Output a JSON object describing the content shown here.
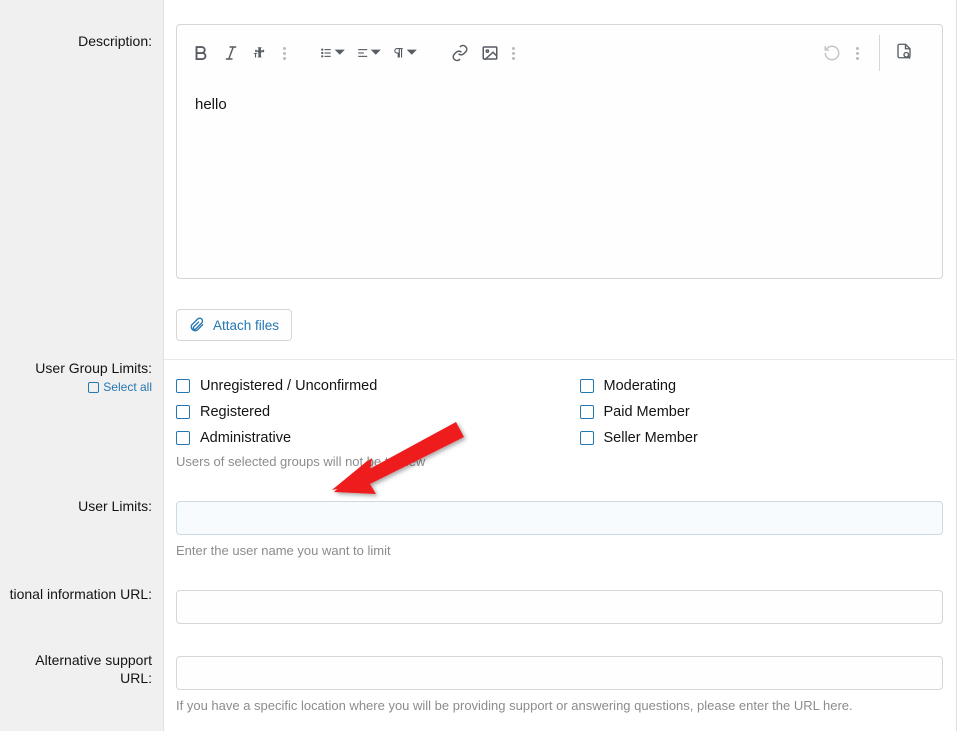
{
  "description": {
    "label": "Description:",
    "content": "hello",
    "attach_label": "Attach files"
  },
  "user_group_limits": {
    "label": "User Group Limits:",
    "select_all": "Select all",
    "left": [
      "Unregistered / Unconfirmed",
      "Registered",
      "Administrative"
    ],
    "right": [
      "Moderating",
      "Paid Member",
      "Seller Member"
    ],
    "helper": "Users of selected groups will not be to view"
  },
  "user_limits": {
    "label": "User Limits:",
    "value": "",
    "helper": "Enter the user name you want to limit"
  },
  "info_url": {
    "label": "tional information URL:",
    "value": ""
  },
  "support_url": {
    "label": "Alternative support URL:",
    "value": "",
    "helper": "If you have a specific location where you will be providing support or answering questions, please enter the URL here."
  }
}
